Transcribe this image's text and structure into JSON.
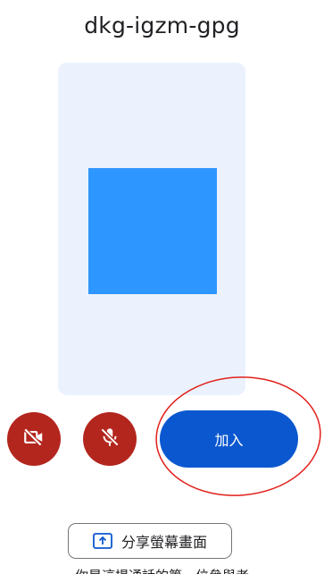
{
  "meeting": {
    "code": "dkg-igzm-gpg"
  },
  "controls": {
    "camera_icon": "videocam-off-icon",
    "mic_icon": "mic-off-icon",
    "join_label": "加入",
    "share_label": "分享螢幕畫面",
    "share_icon": "present-to-all-icon"
  },
  "footer": {
    "note": "你是這場通話的第一位參與者"
  },
  "colors": {
    "off_button": "#b3261e",
    "join_button": "#0b57d0",
    "preview_background": "#e8f0fe",
    "avatar": "#0a84ff",
    "highlight_ring": "#e0201b"
  }
}
